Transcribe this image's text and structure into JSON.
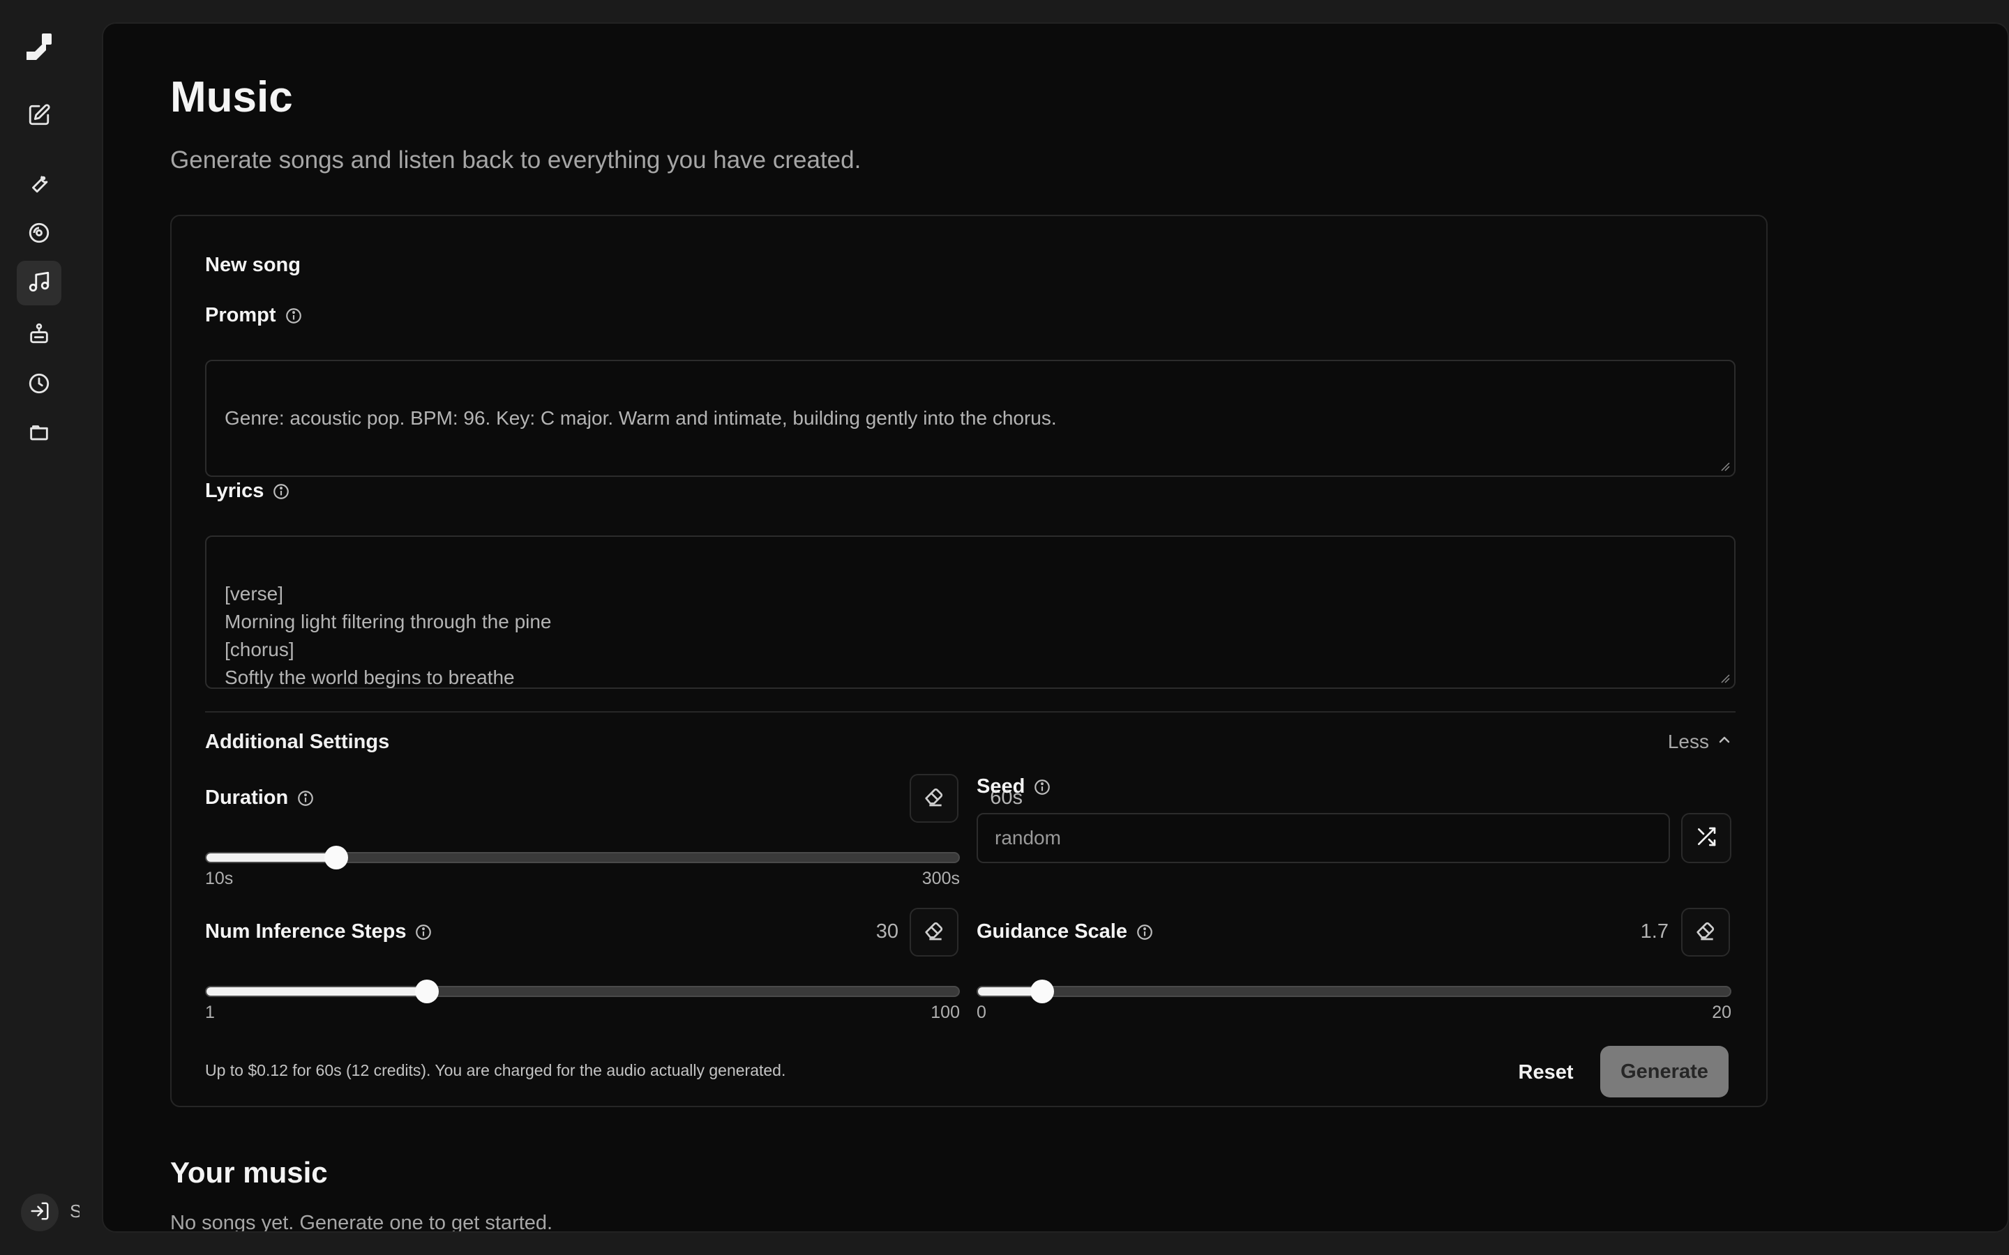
{
  "sidebar": {
    "logo": "logo-icon",
    "items": [
      {
        "icon": "pen-square-icon",
        "label": "Edit"
      },
      {
        "icon": "wrench-icon",
        "label": "Tools"
      },
      {
        "icon": "disc-icon",
        "label": "Disc"
      },
      {
        "icon": "music-note-icon",
        "label": "Music",
        "active": true
      },
      {
        "icon": "robot-icon",
        "label": "Agent"
      },
      {
        "icon": "clock-icon",
        "label": "History"
      },
      {
        "icon": "folder-icon",
        "label": "Files"
      }
    ],
    "login_label": "S"
  },
  "header": {
    "title": "Music",
    "subtitle": "Generate songs and listen back to everything you have created."
  },
  "form": {
    "title": "New song",
    "prompt_label": "Prompt",
    "prompt_value": "Genre: acoustic pop. BPM: 96. Key: C major. Warm and intimate, building gently into the chorus.",
    "lyrics_label": "Lyrics",
    "lyrics_value": "[verse]\nMorning light filtering through the pine\n[chorus]\nSoftly the world begins to breathe",
    "additional_settings_label": "Additional Settings",
    "less_label": "Less",
    "duration": {
      "label": "Duration",
      "value_text": "60s",
      "value": 60,
      "min": 10,
      "max": 300,
      "min_label": "10s",
      "max_label": "300s"
    },
    "seed": {
      "label": "Seed",
      "placeholder": "random"
    },
    "steps": {
      "label": "Num Inference Steps",
      "value_text": "30",
      "value": 30,
      "min": 1,
      "max": 100,
      "min_label": "1",
      "max_label": "100"
    },
    "guidance": {
      "label": "Guidance Scale",
      "value_text": "1.7",
      "value": 1.7,
      "min": 0,
      "max": 20,
      "min_label": "0",
      "max_label": "20"
    },
    "cost_note": "Up to $0.12 for 60s (12 credits). You are charged for the audio actually generated.",
    "reset_label": "Reset",
    "generate_label": "Generate"
  },
  "library": {
    "title": "Your music",
    "empty_text": "No songs yet. Generate one to get started."
  },
  "colors": {
    "background": "#1b1b1b",
    "panel": "#0b0b0b",
    "accent_button": "#7b7b7b",
    "text": "#f4f4f4",
    "muted": "#a6a6a6"
  }
}
